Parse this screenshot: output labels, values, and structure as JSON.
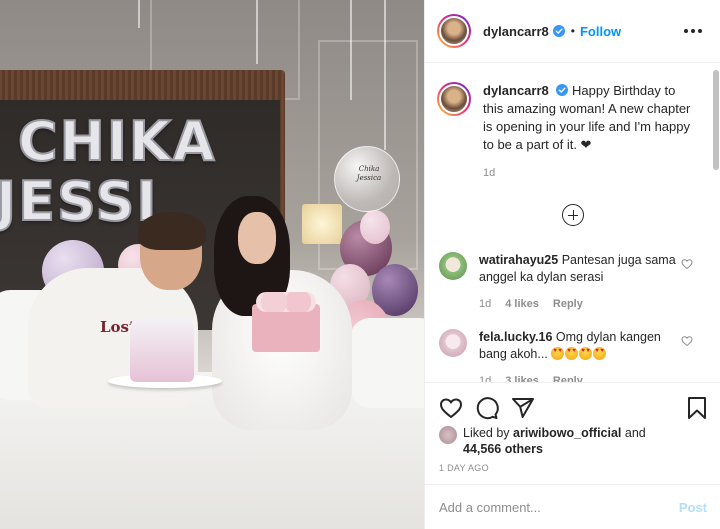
{
  "post": {
    "username": "dylancarr8",
    "verified": true,
    "follow_label": "Follow",
    "separator": "•"
  },
  "photo": {
    "balloon_letters": [
      "CHIKA",
      "JESSI"
    ],
    "tee_text": "Lost",
    "clear_balloon_text": "Chika Jessica"
  },
  "caption": {
    "username": "dylancarr8",
    "text": "Happy Birthday to this amazing woman! A new chapter is opening in your life and I'm happy to be a part of it. ❤",
    "time": "1d"
  },
  "comments": [
    {
      "username": "watirahayu25",
      "text": "Pantesan juga sama anggel ka dylan serasi",
      "time": "1d",
      "likes": "4 likes",
      "reply": "Reply",
      "avatar_color": "#8fbf7a"
    },
    {
      "username": "fela.lucky.16",
      "text": "Omg dylan kangen bang akoh...",
      "emoji_count": 4,
      "emoji_name": "heart-eyes-emoji",
      "time": "1d",
      "likes": "3 likes",
      "reply": "Reply",
      "avatar_color": "#e2c7cf"
    }
  ],
  "likes": {
    "prefix": "Liked by",
    "user": "ariwibowo_official",
    "conjunction": "and",
    "others": "44,566 others"
  },
  "post_date": "1 DAY AGO",
  "add_comment": {
    "placeholder": "Add a comment...",
    "post_label": "Post"
  },
  "icons": {
    "like": "heart-icon",
    "comment": "comment-icon",
    "share": "share-icon",
    "save": "bookmark-icon",
    "more": "more-options-icon",
    "load_more": "plus-circle-icon",
    "verified": "verified-badge-icon"
  },
  "colors": {
    "accent": "#0095f6",
    "text": "#262626",
    "muted": "#8e8e8e",
    "post_disabled": "#b2dffc",
    "story_ring": [
      "#f9ce34",
      "#ee2a7b",
      "#6228d7"
    ]
  }
}
